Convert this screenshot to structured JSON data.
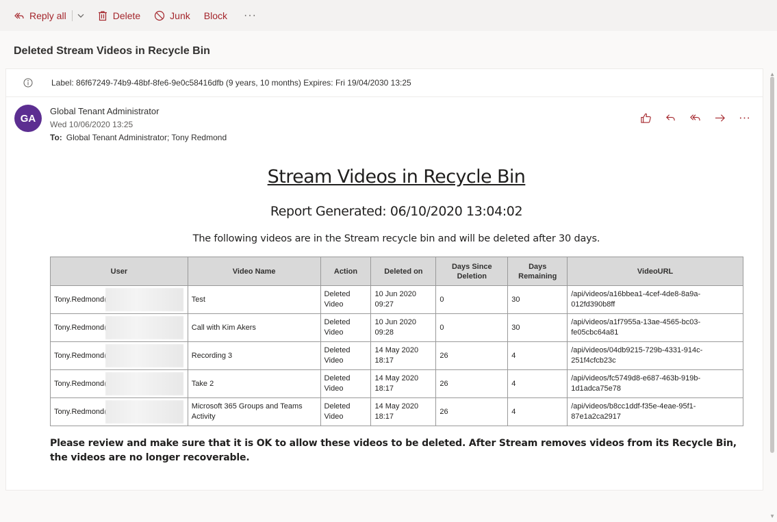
{
  "toolbar": {
    "reply_all": "Reply all",
    "delete": "Delete",
    "junk": "Junk",
    "block": "Block",
    "more": "···"
  },
  "subject": "Deleted Stream Videos in Recycle Bin",
  "label_text": "Label: 86f67249-74b9-48bf-8fe6-9e0c58416dfb (9 years, 10 months) Expires: Fri 19/04/2030 13:25",
  "sender": {
    "initials": "GA",
    "name": "Global Tenant Administrator",
    "date": "Wed 10/06/2020 13:25",
    "to_label": "To:",
    "to": "Global Tenant Administrator; Tony Redmond"
  },
  "body": {
    "title": "Stream Videos in Recycle Bin",
    "generated": "Report Generated: 06/10/2020 13:04:02",
    "description": "The following videos are in the Stream recycle bin and will be deleted after 30 days.",
    "note": "Please review and make sure that it is OK to allow these videos to be deleted. After Stream removes videos from its Recycle Bin, the videos are no longer recoverable."
  },
  "table": {
    "headers": [
      "User",
      "Video Name",
      "Action",
      "Deleted on",
      "Days Since Deletion",
      "Days Remaining",
      "VideoURL"
    ],
    "rows": [
      [
        "Tony.Redmond@",
        "Test",
        "Deleted Video",
        "10 Jun 2020 09:27",
        "0",
        "30",
        "/api/videos/a16bbea1-4cef-4de8-8a9a-012fd390b8ff"
      ],
      [
        "Tony.Redmond@",
        "Call with Kim Akers",
        "Deleted Video",
        "10 Jun 2020 09:28",
        "0",
        "30",
        "/api/videos/a1f7955a-13ae-4565-bc03-fe05cbc64a81"
      ],
      [
        "Tony.Redmond@",
        "Recording 3",
        "Deleted Video",
        "14 May 2020 18:17",
        "26",
        "4",
        "/api/videos/04db9215-729b-4331-914c-251f4cfcb23c"
      ],
      [
        "Tony.Redmond@",
        "Take 2",
        "Deleted Video",
        "14 May 2020 18:17",
        "26",
        "4",
        "/api/videos/fc5749d8-e687-463b-919b-1d1adca75e78"
      ],
      [
        "Tony.Redmond@",
        "Microsoft 365 Groups and Teams Activity",
        "Deleted Video",
        "14 May 2020 18:17",
        "26",
        "4",
        "/api/videos/b8cc1ddf-f35e-4eae-95f1-87e1a2ca2917"
      ]
    ]
  },
  "colors": {
    "accent": "#a4262c",
    "avatar": "#5c2e91"
  }
}
